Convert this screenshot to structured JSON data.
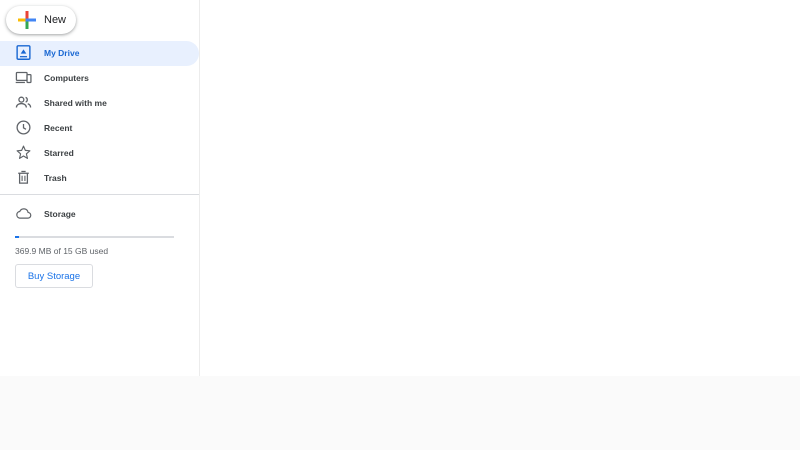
{
  "new_button": {
    "label": "New",
    "icon": "plus-icon"
  },
  "nav": {
    "items": [
      {
        "label": "My Drive",
        "icon": "my-drive-icon",
        "selected": true
      },
      {
        "label": "Computers",
        "icon": "computers-icon",
        "selected": false
      },
      {
        "label": "Shared with me",
        "icon": "shared-with-me-icon",
        "selected": false
      },
      {
        "label": "Recent",
        "icon": "clock-icon",
        "selected": false
      },
      {
        "label": "Starred",
        "icon": "star-icon",
        "selected": false
      },
      {
        "label": "Trash",
        "icon": "trash-icon",
        "selected": false
      }
    ]
  },
  "storage": {
    "label": "Storage",
    "icon": "cloud-icon",
    "usage_text": "369.9 MB of 15 GB used",
    "used_fraction": 0.024,
    "buy_label": "Buy Storage"
  },
  "colors": {
    "accent": "#1a73e8",
    "selected_bg": "#e8f0fe",
    "selected_text": "#1967d2",
    "text": "#3c4043",
    "plus_blue": "#4285f4",
    "plus_red": "#ea4335",
    "plus_yellow": "#fbbc04",
    "plus_green": "#34a853"
  }
}
